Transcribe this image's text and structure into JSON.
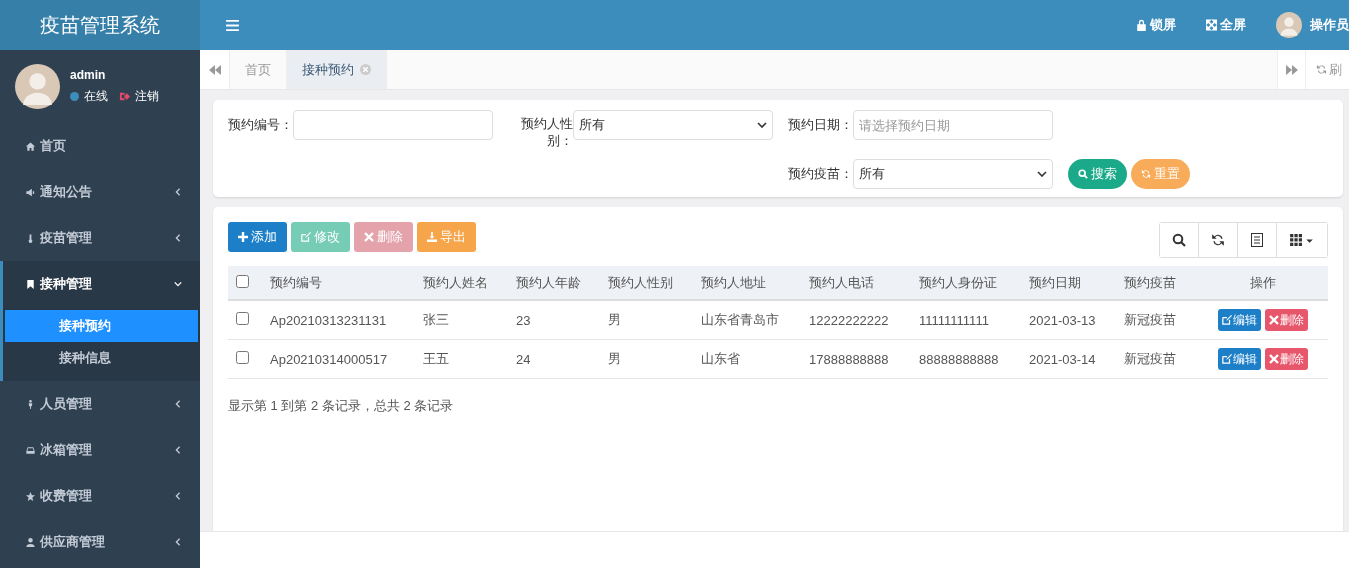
{
  "app_title": "疫苗管理系统",
  "header": {
    "actions": [
      {
        "kind": "lock",
        "label": "锁屏"
      },
      {
        "kind": "fullscreen",
        "label": "全屏"
      }
    ],
    "user_name": "操作员"
  },
  "user_panel": {
    "name": "admin",
    "status": "在线",
    "logout": "注销"
  },
  "sidebar": {
    "items": [
      {
        "kind": "link",
        "label": "首页"
      },
      {
        "kind": "group",
        "label": "通知公告",
        "expanded": false
      },
      {
        "kind": "group",
        "label": "疫苗管理",
        "expanded": false
      },
      {
        "kind": "group",
        "label": "接种管理",
        "expanded": true,
        "children": [
          {
            "label": "接种预约",
            "selected": true
          },
          {
            "label": "接种信息",
            "selected": false
          }
        ]
      },
      {
        "kind": "group",
        "label": "人员管理",
        "expanded": false
      },
      {
        "kind": "group",
        "label": "冰箱管理",
        "expanded": false
      },
      {
        "kind": "group",
        "label": "收费管理",
        "expanded": false
      },
      {
        "kind": "group",
        "label": "供应商管理",
        "expanded": false
      }
    ]
  },
  "tabs": [
    {
      "label": "首页",
      "selected": false
    },
    {
      "label": "接种预约",
      "selected": true
    }
  ],
  "refresh_label": "刷",
  "search_form": {
    "fields": [
      {
        "kind": "text",
        "label": "预约编号："
      },
      {
        "kind": "select",
        "label": "预约人性别：",
        "value": "所有"
      },
      {
        "kind": "text",
        "label": "预约日期：",
        "placeholder": "请选择预约日期"
      },
      {
        "kind": "select",
        "label": "预约疫苗：",
        "value": "所有"
      }
    ],
    "buttons": [
      {
        "kind": "search",
        "label": "搜索"
      },
      {
        "kind": "reset",
        "label": "重置"
      }
    ]
  },
  "toolbar": {
    "buttons": [
      {
        "kind": "add",
        "label": "添加",
        "disabled": false
      },
      {
        "kind": "edit",
        "label": "修改",
        "disabled": true
      },
      {
        "kind": "delete",
        "label": "删除",
        "disabled": true
      },
      {
        "kind": "export",
        "label": "导出",
        "disabled": false
      }
    ],
    "tools": [
      {
        "kind": "search"
      },
      {
        "kind": "refresh"
      },
      {
        "kind": "list"
      },
      {
        "kind": "grid"
      }
    ]
  },
  "table": {
    "select_all": false,
    "columns": [
      "预约编号",
      "预约人姓名",
      "预约人年龄",
      "预约人性别",
      "预约人地址",
      "预约人电话",
      "预约人身份证",
      "预约日期",
      "预约疫苗",
      "操作"
    ],
    "rows": [
      {
        "checked": false,
        "cells": [
          "Ap20210313231131",
          "张三",
          "23",
          "男",
          "山东省青岛市",
          "12222222222",
          "11111111111",
          "2021-03-13",
          "新冠疫苗"
        ],
        "actions": [
          "编辑",
          "删除"
        ]
      },
      {
        "checked": false,
        "cells": [
          "Ap20210314000517",
          "王五",
          "24",
          "男",
          "山东省",
          "17888888888",
          "88888888888",
          "2021-03-14",
          "新冠疫苗"
        ],
        "actions": [
          "编辑",
          "删除"
        ]
      }
    ]
  },
  "pagination_info": "显示第 1 到第 2 条记录，总共 2 条记录"
}
